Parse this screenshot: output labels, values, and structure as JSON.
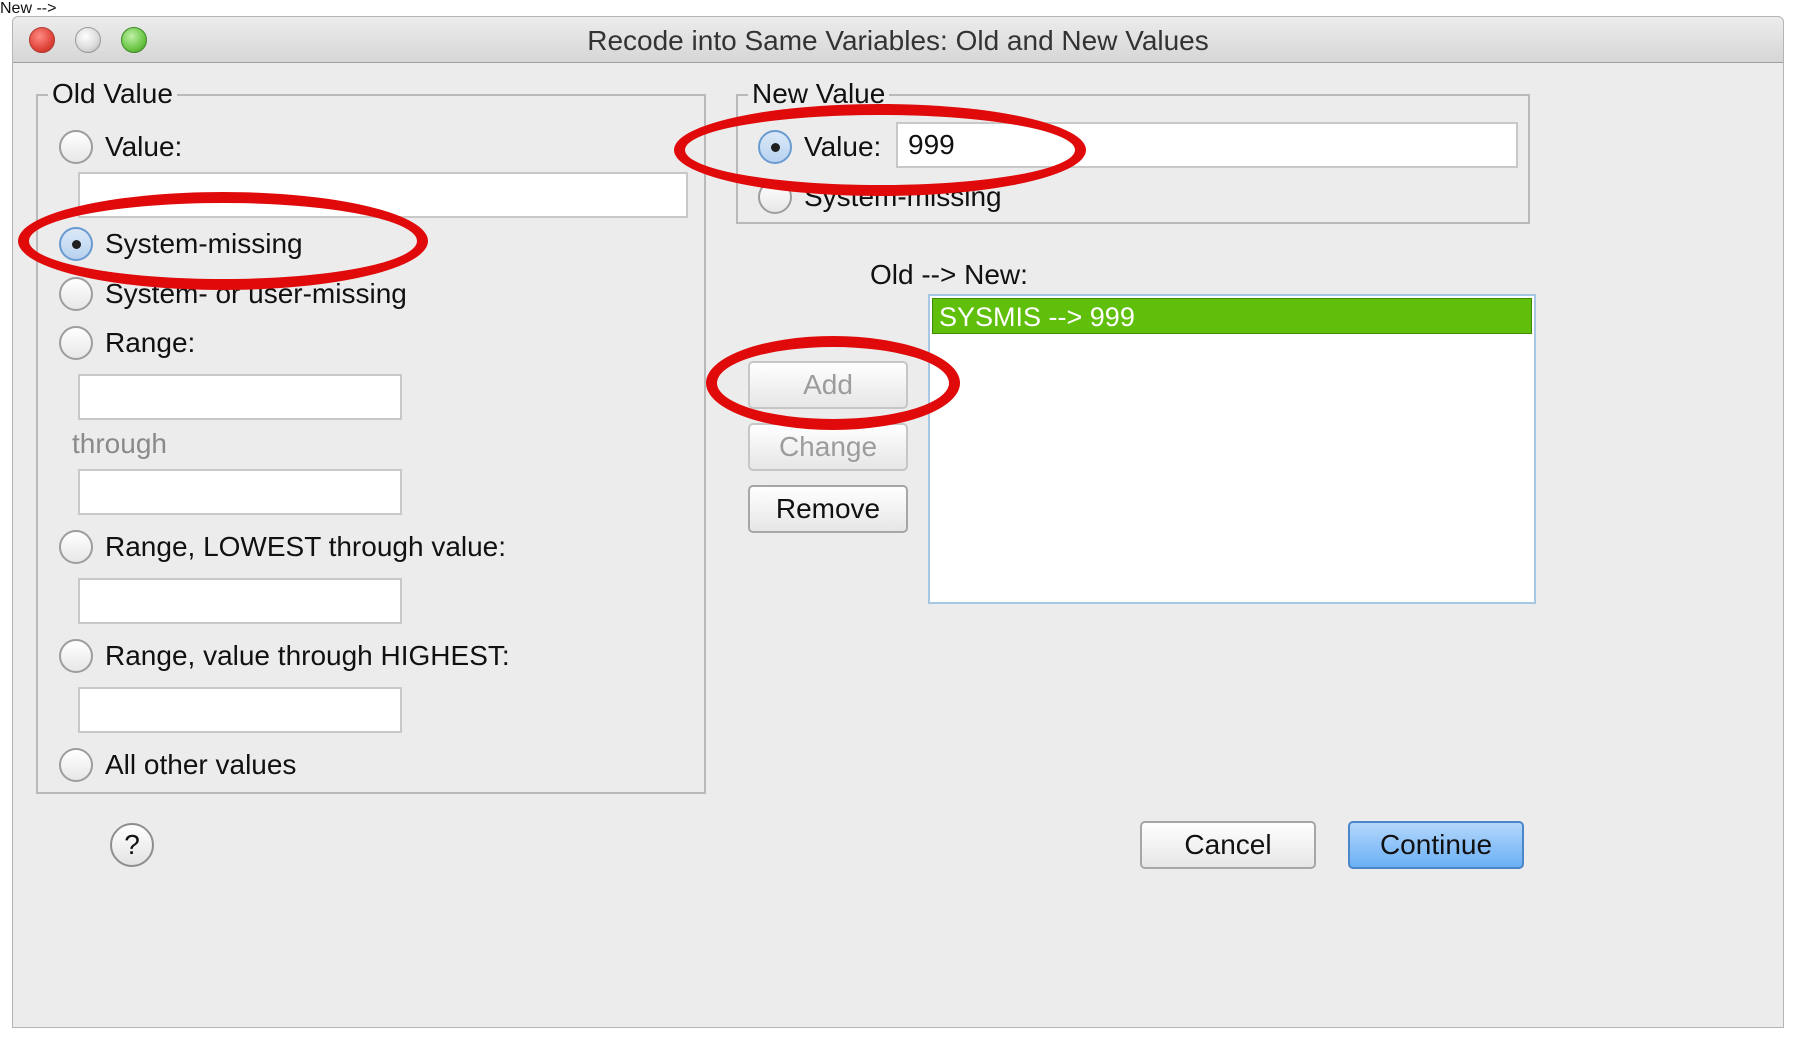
{
  "window": {
    "title": "Recode into Same Variables: Old and New Values"
  },
  "old_value": {
    "group_label": "Old Value",
    "options": {
      "value": "Value:",
      "system_missing": "System-missing",
      "system_or_user_missing": "System- or user-missing",
      "range": "Range:",
      "range_lowest": "Range, LOWEST through value:",
      "range_highest": "Range, value through HIGHEST:",
      "all_other": "All other values"
    },
    "selected": "system_missing",
    "through_label": "through",
    "value_input": "",
    "range_from_input": "",
    "range_to_input": "",
    "lowest_input": "",
    "highest_input": ""
  },
  "new_value": {
    "group_label": "New Value",
    "options": {
      "value": "Value:",
      "system_missing": "System-missing"
    },
    "selected": "value",
    "value_input": "999"
  },
  "mapping": {
    "label": "Old --> New:",
    "items": [
      "SYSMIS --> 999"
    ]
  },
  "buttons": {
    "add": "Add",
    "change": "Change",
    "remove": "Remove",
    "cancel": "Cancel",
    "continue": "Continue",
    "help": "?"
  },
  "colors": {
    "highlight_oval": "#e00a0a",
    "selected_list_item": "#5fbf0a",
    "default_button": "#6ab0f5"
  }
}
